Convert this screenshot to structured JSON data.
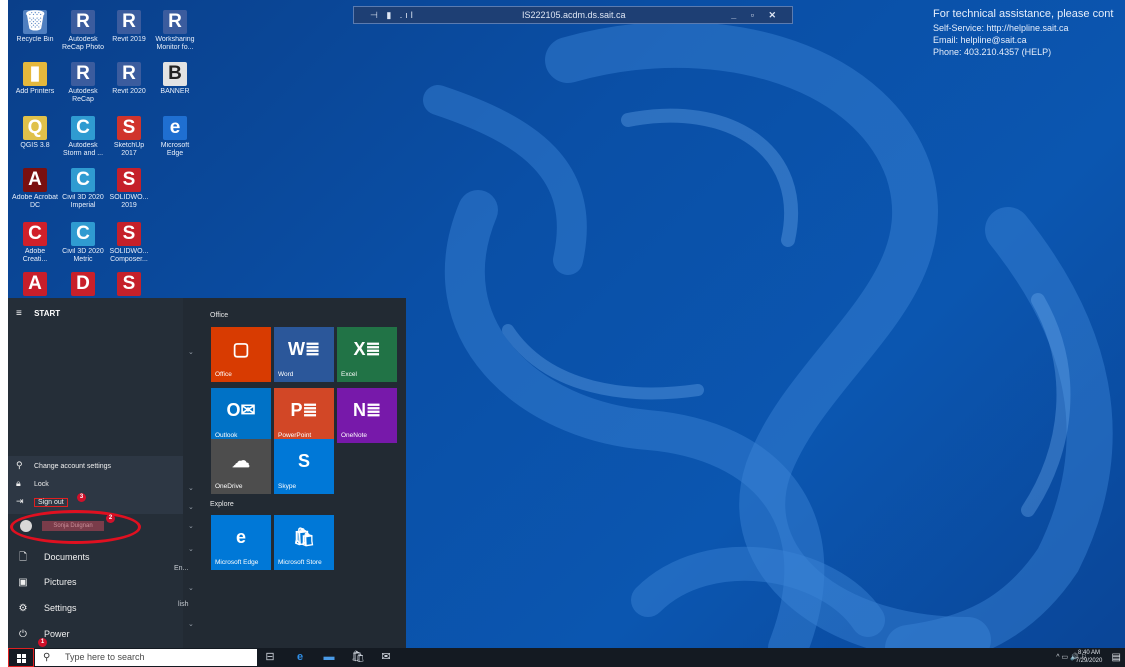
{
  "rdp_bar": {
    "pin_icon": "pin-icon",
    "host": "IS222105.acdm.ds.sait.ca",
    "controls": "_ ▫ ✕"
  },
  "notice": {
    "heading": "For technical assistance, please cont",
    "self_service": "Self-Service: http://helpline.sait.ca",
    "email": "Email: helpline@sait.ca",
    "phone": "Phone: 403.210.4357 (HELP)"
  },
  "desktop_icons": [
    {
      "name": "Recycle Bin",
      "glyph": "🗑",
      "bg": "#4f7fc0"
    },
    {
      "name": "Autodesk ReCap Photo",
      "glyph": "R",
      "bg": "#3b5c9e"
    },
    {
      "name": "Revit 2019",
      "glyph": "R",
      "bg": "#3b5c9e"
    },
    {
      "name": "Worksharing Monitor fo...",
      "glyph": "R",
      "bg": "#3b5c9e"
    },
    {
      "name": "Add Printers",
      "glyph": "▮",
      "bg": "#e5b83c"
    },
    {
      "name": "Autodesk ReCap",
      "glyph": "R",
      "bg": "#3b5c9e"
    },
    {
      "name": "Revit 2020",
      "glyph": "R",
      "bg": "#3b5c9e"
    },
    {
      "name": "BANNER",
      "glyph": "B",
      "bg": "#e3e3e3"
    },
    {
      "name": "QGIS 3.8",
      "glyph": "Q",
      "bg": "#e0c14a"
    },
    {
      "name": "Autodesk Storm and ...",
      "glyph": "C",
      "bg": "#2f9bd1"
    },
    {
      "name": "SketchUp 2017",
      "glyph": "S",
      "bg": "#d0342c"
    },
    {
      "name": "Microsoft Edge",
      "glyph": "e",
      "bg": "#1f6fd1"
    },
    {
      "name": "Adobe Acrobat DC",
      "glyph": "A",
      "bg": "#7a1010"
    },
    {
      "name": "Civil 3D 2020 Imperial",
      "glyph": "C",
      "bg": "#2f9bd1"
    },
    {
      "name": "SOLIDWO... 2019",
      "glyph": "S",
      "bg": "#c5202a"
    },
    {
      "name": "Adobe Creati...",
      "glyph": "C",
      "bg": "#d0202a"
    },
    {
      "name": "Civil 3D 2020 Metric",
      "glyph": "C",
      "bg": "#2f9bd1"
    },
    {
      "name": "SOLIDWO... Composer...",
      "glyph": "S",
      "bg": "#c5202a"
    },
    {
      "name": "",
      "glyph": "A",
      "bg": "#c81e2a"
    },
    {
      "name": "",
      "glyph": "D",
      "bg": "#c8202a"
    },
    {
      "name": "",
      "glyph": "S",
      "bg": "#c5202a"
    }
  ],
  "start_menu": {
    "header": "START",
    "account_flyout": {
      "change_settings": "Change account settings",
      "lock": "Lock",
      "sign_out": "Sign out"
    },
    "user_name": "Sonja Duignan",
    "rail_items": [
      "Documents",
      "Pictures",
      "Settings",
      "Power"
    ],
    "fragments": [
      "En...",
      "lish"
    ],
    "steps": [
      "1",
      "2",
      "3"
    ],
    "groups": [
      "Office",
      "Explore"
    ],
    "tiles": [
      {
        "label": "Office",
        "glyph": "▢",
        "color": "#d83b01"
      },
      {
        "label": "Word",
        "glyph": "W≣",
        "color": "#2b579a"
      },
      {
        "label": "Excel",
        "glyph": "X≣",
        "color": "#217346"
      },
      {
        "label": "Outlook",
        "glyph": "O✉",
        "color": "#0072c6"
      },
      {
        "label": "PowerPoint",
        "glyph": "P≣",
        "color": "#d24726"
      },
      {
        "label": "OneNote",
        "glyph": "N≣",
        "color": "#7719aa"
      },
      {
        "label": "OneDrive",
        "glyph": "☁",
        "color": "#4d4d4d"
      },
      {
        "label": "Skype",
        "glyph": "S",
        "color": "#0078d7"
      },
      {
        "label": "Microsoft Edge",
        "glyph": "e",
        "color": "#0078d7"
      },
      {
        "label": "Microsoft Store",
        "glyph": "🛍",
        "color": "#0078d7"
      }
    ]
  },
  "taskbar": {
    "search_placeholder": "Type here to search",
    "tray": "^ ▭ 🔊 ⚐",
    "time": "8:40 AM",
    "date": "7/29/2020"
  }
}
